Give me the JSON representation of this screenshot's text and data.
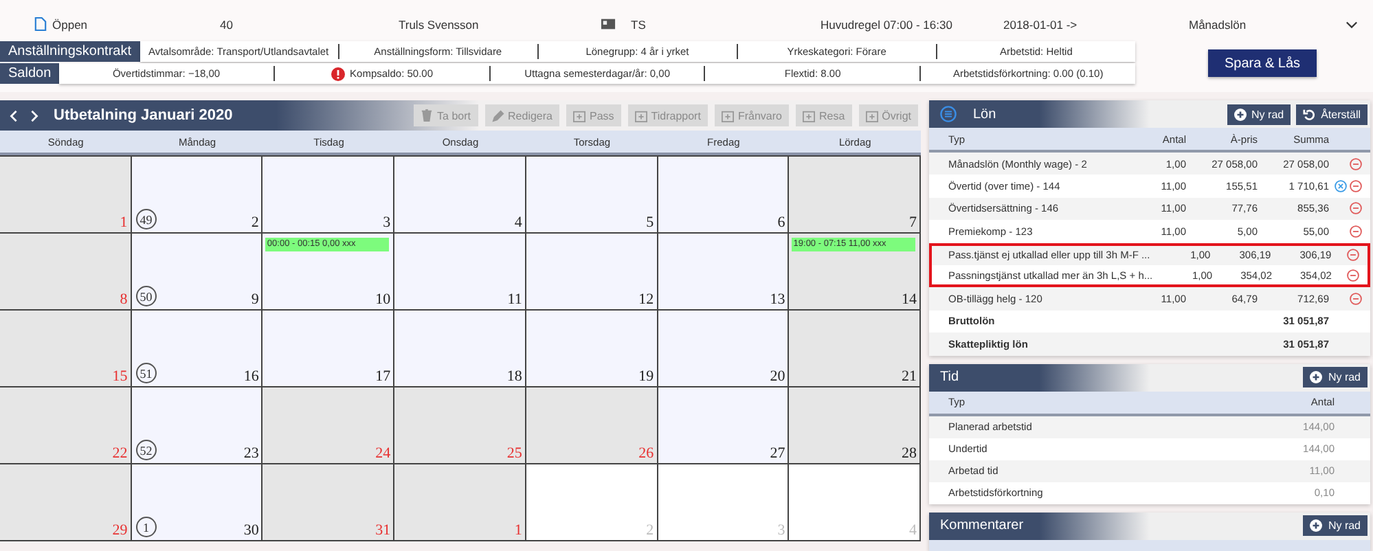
{
  "header": {
    "status": "Öppen",
    "number": "40",
    "name": "Truls Svensson",
    "initials": "TS",
    "rule": "Huvudregel 07:00 - 16:30",
    "date": "2018-01-01 ->",
    "salary_type": "Månadslön"
  },
  "contract": {
    "title": "Anställningskontrakt",
    "items": [
      "Avtalsområde: Transport/Utlandsavtalet",
      "Anställningsform: Tillsvidare",
      "Lönegrupp: 4 år i yrket",
      "Yrkeskategori: Förare",
      "Arbetstid: Heltid"
    ]
  },
  "balances": {
    "title": "Saldon",
    "items": [
      {
        "text": "Övertidstimmar: −18,00",
        "warning": false
      },
      {
        "text": "Kompsaldo: 50.00",
        "warning": true
      },
      {
        "text": "Uttagna semesterdagar/år: 0,00",
        "warning": false
      },
      {
        "text": "Flextid: 8.00",
        "warning": false
      },
      {
        "text": "Arbetstidsförkortning: 0.00 (0.10)",
        "warning": false
      }
    ]
  },
  "save_button": "Spara & Lås",
  "calendar": {
    "title": "Utbetalning Januari 2020",
    "toolbar": [
      {
        "label": "Ta bort",
        "disabled": true
      },
      {
        "label": "Redigera",
        "disabled": true
      },
      {
        "label": "Pass",
        "disabled": true
      },
      {
        "label": "Tidrapport",
        "disabled": true
      },
      {
        "label": "Frånvaro",
        "disabled": true
      },
      {
        "label": "Resa",
        "disabled": true
      },
      {
        "label": "Övrigt",
        "disabled": true
      }
    ],
    "weekdays": [
      "Söndag",
      "Måndag",
      "Tisdag",
      "Onsdag",
      "Torsdag",
      "Fredag",
      "Lördag"
    ],
    "weeks": [
      {
        "week": "49",
        "days": [
          {
            "day": "1",
            "kind": "off",
            "red": true
          },
          {
            "day": "2",
            "kind": "work",
            "red": false
          },
          {
            "day": "3",
            "kind": "work",
            "red": false
          },
          {
            "day": "4",
            "kind": "work",
            "red": false
          },
          {
            "day": "5",
            "kind": "work",
            "red": false
          },
          {
            "day": "6",
            "kind": "work",
            "red": false
          },
          {
            "day": "7",
            "kind": "off",
            "red": false
          }
        ]
      },
      {
        "week": "50",
        "days": [
          {
            "day": "8",
            "kind": "off",
            "red": true
          },
          {
            "day": "9",
            "kind": "work",
            "red": false
          },
          {
            "day": "10",
            "kind": "work",
            "red": false,
            "event": "00:00 - 00:15 0,00 xxx"
          },
          {
            "day": "11",
            "kind": "work",
            "red": false
          },
          {
            "day": "12",
            "kind": "work",
            "red": false
          },
          {
            "day": "13",
            "kind": "work",
            "red": false
          },
          {
            "day": "14",
            "kind": "off",
            "red": false,
            "event": "19:00 - 07:15 11,00 xxx"
          }
        ]
      },
      {
        "week": "51",
        "days": [
          {
            "day": "15",
            "kind": "off",
            "red": true
          },
          {
            "day": "16",
            "kind": "work",
            "red": false
          },
          {
            "day": "17",
            "kind": "work",
            "red": false
          },
          {
            "day": "18",
            "kind": "work",
            "red": false
          },
          {
            "day": "19",
            "kind": "work",
            "red": false
          },
          {
            "day": "20",
            "kind": "work",
            "red": false
          },
          {
            "day": "21",
            "kind": "off",
            "red": false
          }
        ]
      },
      {
        "week": "52",
        "days": [
          {
            "day": "22",
            "kind": "off",
            "red": true
          },
          {
            "day": "23",
            "kind": "work",
            "red": false
          },
          {
            "day": "24",
            "kind": "off",
            "red": true
          },
          {
            "day": "25",
            "kind": "off",
            "red": true
          },
          {
            "day": "26",
            "kind": "off",
            "red": true
          },
          {
            "day": "27",
            "kind": "work",
            "red": false
          },
          {
            "day": "28",
            "kind": "off",
            "red": false
          }
        ]
      },
      {
        "week": "1",
        "days": [
          {
            "day": "29",
            "kind": "off",
            "red": true
          },
          {
            "day": "30",
            "kind": "work",
            "red": false
          },
          {
            "day": "31",
            "kind": "off",
            "red": true
          },
          {
            "day": "1",
            "kind": "off",
            "red": true
          },
          {
            "day": "2",
            "kind": "outside"
          },
          {
            "day": "3",
            "kind": "outside"
          },
          {
            "day": "4",
            "kind": "outside"
          }
        ]
      }
    ]
  },
  "salary": {
    "title": "Lön",
    "buttons": [
      "Ny rad",
      "Återställ"
    ],
    "columns": [
      "Typ",
      "Antal",
      "À-pris",
      "Summa"
    ],
    "rows": [
      {
        "kind": "item",
        "type": "Månadslön (Monthly wage) - 2",
        "count": "1,00",
        "price": "27 058,00",
        "sum": "27 058,00",
        "info": false,
        "highlighted": false
      },
      {
        "kind": "item",
        "type": "Övertid (over time) - 144",
        "count": "11,00",
        "price": "155,51",
        "sum": "1 710,61",
        "info": true,
        "highlighted": false
      },
      {
        "kind": "item",
        "type": "Övertidsersättning - 146",
        "count": "11,00",
        "price": "77,76",
        "sum": "855,36",
        "info": false,
        "highlighted": false
      },
      {
        "kind": "item",
        "type": "Premiekomp - 123",
        "count": "11,00",
        "price": "5,00",
        "sum": "55,00",
        "info": false,
        "highlighted": false
      },
      {
        "kind": "item",
        "type": "Pass.tjänst ej utkallad eller upp till 3h M-F ...",
        "count": "1,00",
        "price": "306,19",
        "sum": "306,19",
        "info": false,
        "highlighted": true
      },
      {
        "kind": "item",
        "type": "Passningstjänst utkallad mer än 3h L,S + h...",
        "count": "1,00",
        "price": "354,02",
        "sum": "354,02",
        "info": false,
        "highlighted": true
      },
      {
        "kind": "item",
        "type": "OB-tillägg helg - 120",
        "count": "11,00",
        "price": "64,79",
        "sum": "712,69",
        "info": false,
        "highlighted": false
      },
      {
        "kind": "total",
        "type": "Bruttolön",
        "sum": "31 051,87"
      },
      {
        "kind": "total",
        "type": "Skattepliktig lön",
        "sum": "31 051,87"
      }
    ]
  },
  "time": {
    "title": "Tid",
    "button": "Ny rad",
    "columns": [
      "Typ",
      "Antal"
    ],
    "rows": [
      {
        "type": "Planerad arbetstid",
        "count": "144,00"
      },
      {
        "type": "Undertid",
        "count": "144,00"
      },
      {
        "type": "Arbetad tid",
        "count": "11,00"
      },
      {
        "type": "Arbetstidsförkortning",
        "count": "0,10"
      }
    ]
  },
  "comments": {
    "title": "Kommentarer",
    "button": "Ny rad"
  }
}
